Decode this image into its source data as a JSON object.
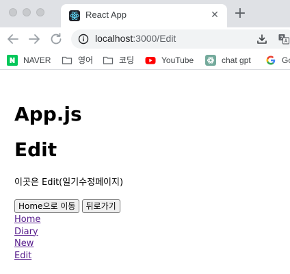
{
  "browser": {
    "tab_title": "React App",
    "tab_close_glyph": "✕",
    "new_tab_glyph": "+",
    "url_host": "localhost",
    "url_path": ":3000/Edit"
  },
  "bookmarks": [
    {
      "label": "NAVER",
      "icon": "naver-icon",
      "color": "#03c75a"
    },
    {
      "label": "영어",
      "icon": "folder-icon"
    },
    {
      "label": "코딩",
      "icon": "folder-icon"
    },
    {
      "label": "YouTube",
      "icon": "youtube-icon",
      "color": "#ff0000"
    },
    {
      "label": "chat gpt",
      "icon": "chatgpt-icon",
      "color": "#74aa9c"
    },
    {
      "label": "Go",
      "icon": "google-icon"
    }
  ],
  "page": {
    "app_title": "App.js",
    "page_title": "Edit",
    "description": "이곳은 Edit(일기수정페이지)",
    "buttons": {
      "home": "Home으로 이동",
      "back": "뒤로가기"
    },
    "links": [
      "Home",
      "Diary",
      "New",
      "Edit"
    ]
  },
  "colors": {
    "tab_strip": "#dfe1e5",
    "omnibox": "#f1f3f4",
    "visited_link": "#551a8b"
  }
}
